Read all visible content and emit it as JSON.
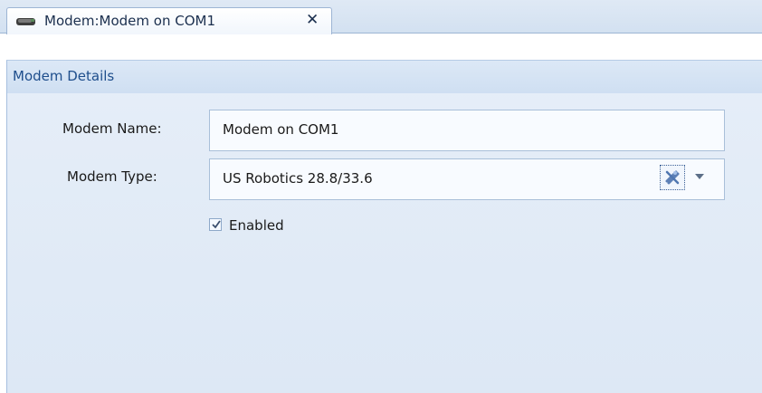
{
  "tab": {
    "title": "Modem:Modem on COM1",
    "close_glyph": "✕",
    "icon": "modem-icon"
  },
  "panel": {
    "header": "Modem Details"
  },
  "form": {
    "modem_name_label": "Modem Name:",
    "modem_name_value": "Modem on COM1",
    "modem_type_label": "Modem Type:",
    "modem_type_value": "US Robotics 28.8/33.6",
    "enabled_label": "Enabled",
    "enabled_checked": true
  },
  "icons": {
    "clear": "clear-field-icon",
    "dropdown": "chevron-down-icon",
    "checkbox": "checkmark-icon"
  }
}
